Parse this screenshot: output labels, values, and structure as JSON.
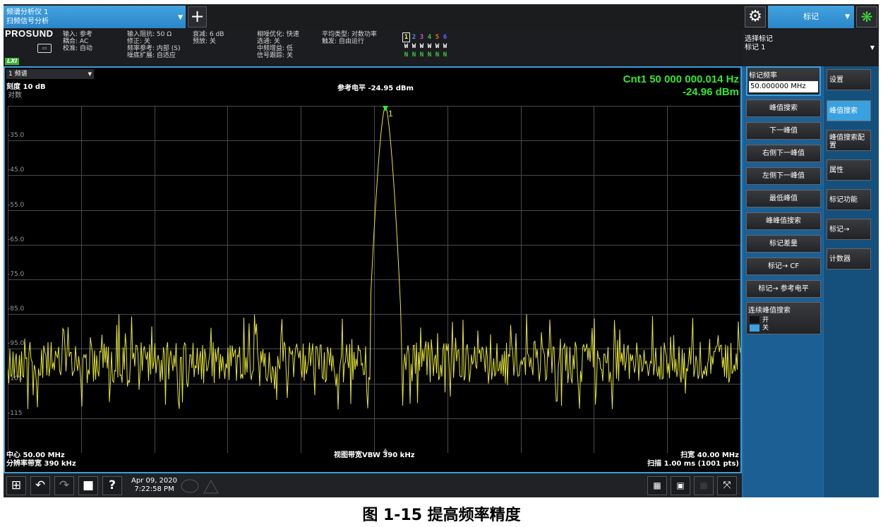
{
  "mode": {
    "line1": "频谱分析仪 1",
    "line2": "扫频信号分析"
  },
  "menu_select": "标记",
  "logo": "PROSUND",
  "lxi": "LXI",
  "info": {
    "col1": [
      "输入: 参考",
      "耦合: AC",
      "校准: 自动"
    ],
    "col2": [
      "输入阻抗: 50 Ω",
      "修正: 关",
      "频率参考: 内部 (S)",
      "噪底扩展: 自适应"
    ],
    "col3": [
      "衰减: 6 dB",
      "预放: 关"
    ],
    "col4": [
      "相噪优化: 快速",
      "选通: 关",
      "中频增益: 低",
      "信号跟踪: 关"
    ],
    "col5": [
      "平均类型: 对数功率",
      "触发: 自由运行"
    ]
  },
  "traces": {
    "numbers": [
      "1",
      "2",
      "3",
      "4",
      "5",
      "6"
    ],
    "types": [
      "W",
      "W",
      "W",
      "W",
      "W",
      "W"
    ],
    "detectors": [
      "N",
      "N",
      "N",
      "N",
      "N",
      "N"
    ],
    "colors": [
      "#f4f434",
      "#3aa1e0",
      "#c850c8",
      "#3ec93e",
      "#e66b2a",
      "#5a66ff"
    ]
  },
  "select_marker": {
    "label": "选择标记",
    "value": "标记 1"
  },
  "trace_select": "1 频谱",
  "scale": "刻度 10 dB",
  "scale_type": "对数",
  "ref_level": "参考电平 -24.95 dBm",
  "marker_readout": {
    "freq": "Cnt1 50 000 000.014 Hz",
    "level": "-24.96 dBm"
  },
  "marker_number": "1",
  "y_labels": [
    "-35.0",
    "-45.0",
    "-55.0",
    "-65.0",
    "-75.0",
    "-85.0",
    "-95.0",
    "-105",
    "-115"
  ],
  "bottom": {
    "center": "中心 50.00 MHz",
    "rbw": "分辨率带宽 390 kHz",
    "vbw": "视图带宽VBW 390 kHz",
    "span": "扫宽 40.00 MHz",
    "sweep": "扫描 1.00 ms (1001 pts)"
  },
  "datetime": {
    "date": "Apr 09, 2020",
    "time": "7:22:58 PM"
  },
  "softkeys_left": {
    "freq_label": "标记频率",
    "freq_value": "50.000000 MHz",
    "buttons": [
      "峰值搜索",
      "下一峰值",
      "右侧下一峰值",
      "左侧下一峰值",
      "最低峰值",
      "峰峰值搜索",
      "标记差量",
      "标记→ CF",
      "标记→ 参考电平"
    ],
    "cont_label": "连续峰值搜索",
    "on": "开",
    "off": "关"
  },
  "softkeys_right": [
    "设置",
    "峰值搜索",
    "峰值搜索配置",
    "属性",
    "标记功能",
    "标记→",
    "计数器"
  ],
  "icons": {
    "gear": "⚙",
    "add": "+",
    "busy": "❋",
    "windows": "⊞",
    "undo": "↶",
    "redo": "↷",
    "folder": "■",
    "help": "?"
  },
  "caption": "图 1-15 提高频率精度"
}
